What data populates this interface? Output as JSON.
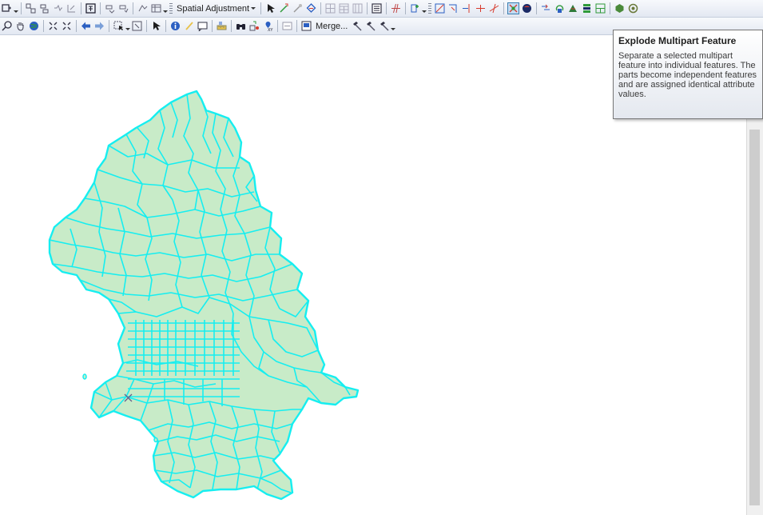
{
  "toolbar_top": {
    "spatial_adjustment_label": "Spatial Adjustment"
  },
  "toolbar_bottom": {
    "merge_label": "Merge..."
  },
  "tooltip": {
    "title": "Explode Multipart Feature",
    "body": "Separate a selected multipart feature into individual features. The parts become independent features and are assigned identical attribute values."
  },
  "map": {
    "fill_color": "#c8ebc8",
    "outline_color": "#16eef0",
    "cursor_icon": "x-marker-icon"
  },
  "colors": {
    "toolbar_bg": "#e8ecf4",
    "active_button_border": "#3c7fb1",
    "red_icon": "#d73a2c",
    "green_icon": "#2f9a3a",
    "blue_icon": "#2b5fc2"
  }
}
